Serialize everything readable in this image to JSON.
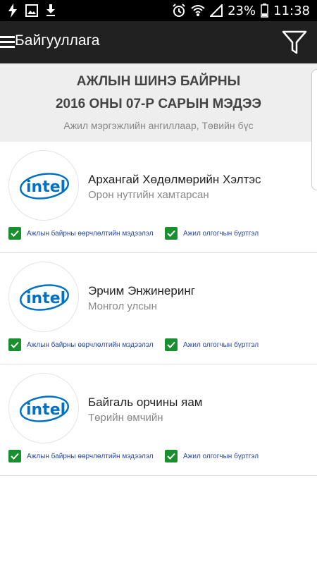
{
  "status_bar": {
    "battery": "23%",
    "time": "11:38",
    "icons": [
      "flash-icon",
      "image-icon",
      "download-icon",
      "alarm-icon",
      "wifi-icon",
      "signal-icon",
      "battery-icon"
    ]
  },
  "app_bar": {
    "title": "Байгууллага",
    "menu_icon": "hamburger-menu-icon",
    "filter_icon": "filter-icon"
  },
  "header": {
    "line1": "АЖЛЫН ШИНЭ БАЙРНЫ",
    "line2": "2016 ОНЫ 07-Р САРЫН МЭДЭЭ",
    "subtitle": "Ажил мэргэжлийн ангиллаар, Төвийн бүс"
  },
  "colors": {
    "app_bar": "#212121",
    "checkbox": "#1a8f2f",
    "link_text": "#2746a8",
    "intel_blue": "#0071c5"
  },
  "organizations": [
    {
      "logo_text": "intel",
      "name": "Архангай Хөдөлмөрийн Хэлтэс",
      "subtitle": "Орон нутгийн хамтарсан",
      "check1": "Ажлын байрны өөрчлөлтийн мэдээлэл",
      "check2": "Ажил олгогчын бүртгэл"
    },
    {
      "logo_text": "intel",
      "name": "Эрчим Энжинеринг",
      "subtitle": "Монгол улсын",
      "check1": "Ажлын байрны өөрчлөлтийн мэдээлэл",
      "check2": "Ажил олгогчын бүртгэл"
    },
    {
      "logo_text": "intel",
      "name": "Байгаль орчины яам",
      "subtitle": "Төрийн өмчийн",
      "check1": "Ажлын байрны өөрчлөлтийн мэдээлэл",
      "check2": "Ажил олгогчын бүртгэл"
    }
  ]
}
